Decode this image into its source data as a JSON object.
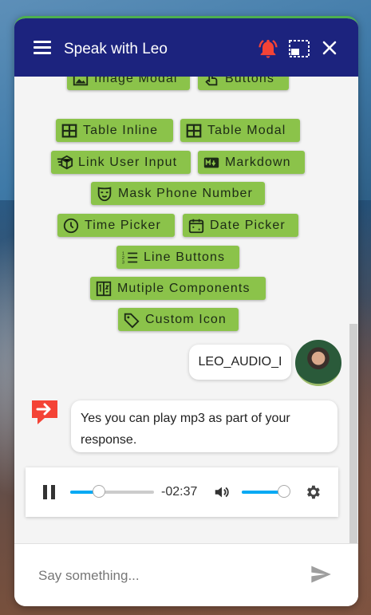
{
  "header": {
    "title": "Speak with Leo",
    "icons": [
      "menu-icon",
      "bell-icon",
      "expand-icon",
      "close-icon"
    ],
    "bell_color": "#f44336",
    "bg_color": "#1c237e"
  },
  "buttons": [
    {
      "label": "Image Modal",
      "icon": "image-icon"
    },
    {
      "label": "Buttons",
      "icon": "touch-icon"
    },
    {
      "label": "Table Inline",
      "icon": "table-icon"
    },
    {
      "label": "Table Modal",
      "icon": "table-icon"
    },
    {
      "label": "Link User Input",
      "icon": "link-input-icon"
    },
    {
      "label": "Markdown",
      "icon": "markdown-icon"
    },
    {
      "label": "Mask Phone Number",
      "icon": "mask-icon"
    },
    {
      "label": "Time Picker",
      "icon": "clock-icon"
    },
    {
      "label": "Date Picker",
      "icon": "calendar-icon"
    },
    {
      "label": "Line Buttons",
      "icon": "list-icon"
    },
    {
      "label": "Mutiple Components",
      "icon": "components-icon"
    },
    {
      "label": "Custom Icon",
      "icon": "tag-icon"
    }
  ],
  "chip_color": "#8bc34a",
  "messages": {
    "user_text": "LEO_AUDIO_I",
    "bot_text": "Yes you can play mp3 as part of your response."
  },
  "audio": {
    "time": "-02:37",
    "progress": 0.34,
    "volume": 0.88,
    "accent": "#03a9f4"
  },
  "footer": {
    "placeholder": "Say something..."
  }
}
